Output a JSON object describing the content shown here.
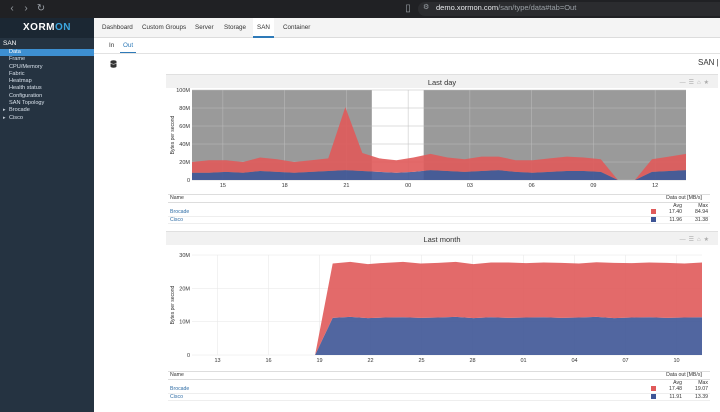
{
  "browser": {
    "url_host": "demo.xormon.com",
    "url_path": "/san/type/data#tab=Out"
  },
  "logo": {
    "left": "XORM",
    "right": "ON"
  },
  "sidebar": {
    "title": "SAN",
    "items": [
      {
        "label": "Data",
        "active": true
      },
      {
        "label": "Frame"
      },
      {
        "label": "CPU/Memory"
      },
      {
        "label": "Fabric"
      },
      {
        "label": "Heatmap"
      },
      {
        "label": "Health status"
      },
      {
        "label": "Configuration"
      },
      {
        "label": "SAN Topology"
      },
      {
        "label": "Brocade",
        "expandable": true
      },
      {
        "label": "Cisco",
        "expandable": true
      }
    ]
  },
  "top_nav": [
    "Dashboard",
    "Custom Groups",
    "Server",
    "Storage",
    "SAN",
    "Container"
  ],
  "sub_nav": [
    "In",
    "Out"
  ],
  "page_heading": "SAN | …",
  "panels": [
    {
      "title": "Last day",
      "legend": {
        "name_header": "Name",
        "metric_header": "Data out [MB/s]",
        "avg_header": "Avg",
        "max_header": "Max",
        "rows": [
          {
            "name": "Brocade",
            "color": "#e05a5a",
            "avg": "17.40",
            "max": "84.94"
          },
          {
            "name": "Cisco",
            "color": "#3e5596",
            "avg": "11.96",
            "max": "31.38"
          }
        ]
      }
    },
    {
      "title": "Last month",
      "legend": {
        "name_header": "Name",
        "metric_header": "Data out [MB/s]",
        "avg_header": "Avg",
        "max_header": "Max",
        "rows": [
          {
            "name": "Brocade",
            "color": "#e05a5a",
            "avg": "17.48",
            "max": "19.07"
          },
          {
            "name": "Cisco",
            "color": "#3e5596",
            "avg": "11.91",
            "max": "13.39"
          }
        ]
      }
    }
  ],
  "chart_data": [
    {
      "type": "area",
      "title": "Last day",
      "ylabel": "Bytes per second",
      "x": [
        "15",
        "18",
        "21",
        "00",
        "03",
        "06",
        "09",
        "12"
      ],
      "yticks": [
        "0",
        "20M",
        "40M",
        "60M",
        "80M",
        "100M"
      ],
      "ylim": [
        0,
        100
      ],
      "series": [
        {
          "name": "Cisco",
          "color": "#3e5596",
          "values": [
            8,
            8,
            9,
            8,
            10,
            9,
            8,
            9,
            10,
            11,
            10,
            9,
            8,
            9,
            11,
            10,
            9,
            10,
            11,
            9,
            8,
            9,
            10,
            10,
            9,
            0,
            0,
            9,
            10,
            11
          ]
        },
        {
          "name": "Brocade",
          "color": "#e05a5a",
          "values": [
            12,
            14,
            13,
            12,
            15,
            14,
            12,
            13,
            14,
            70,
            20,
            15,
            14,
            16,
            18,
            15,
            14,
            16,
            15,
            13,
            14,
            15,
            16,
            15,
            14,
            0,
            0,
            14,
            16,
            18
          ]
        }
      ],
      "grey_bands": "before 19, after 21",
      "grid": true
    },
    {
      "type": "area",
      "title": "Last month",
      "ylabel": "Bytes per second",
      "x": [
        "13",
        "16",
        "19",
        "22",
        "25",
        "28",
        "01",
        "04",
        "07",
        "10"
      ],
      "yticks": [
        "0",
        "10M",
        "20M",
        "30M"
      ],
      "ylim": [
        0,
        32
      ],
      "series": [
        {
          "name": "Cisco",
          "color": "#3e5596",
          "values": [
            0,
            0,
            0,
            0,
            0,
            0,
            0,
            0,
            11.9,
            12.2,
            11.8,
            12.0,
            12.1,
            11.9,
            12.0,
            12.2,
            11.8,
            12.1,
            11.9,
            12.0,
            12.1,
            11.9,
            12.0,
            12.2,
            11.8,
            12.0,
            12.1,
            11.9,
            12.0,
            12.1
          ]
        },
        {
          "name": "Brocade",
          "color": "#e05a5a",
          "values": [
            0,
            0,
            0,
            0,
            0,
            0,
            0,
            0,
            17.4,
            17.6,
            17.3,
            17.5,
            17.7,
            17.4,
            17.5,
            17.6,
            17.3,
            17.5,
            17.7,
            17.4,
            17.5,
            17.6,
            17.3,
            17.5,
            17.7,
            17.4,
            17.5,
            17.6,
            17.3,
            17.5
          ]
        }
      ],
      "grid": true
    }
  ]
}
